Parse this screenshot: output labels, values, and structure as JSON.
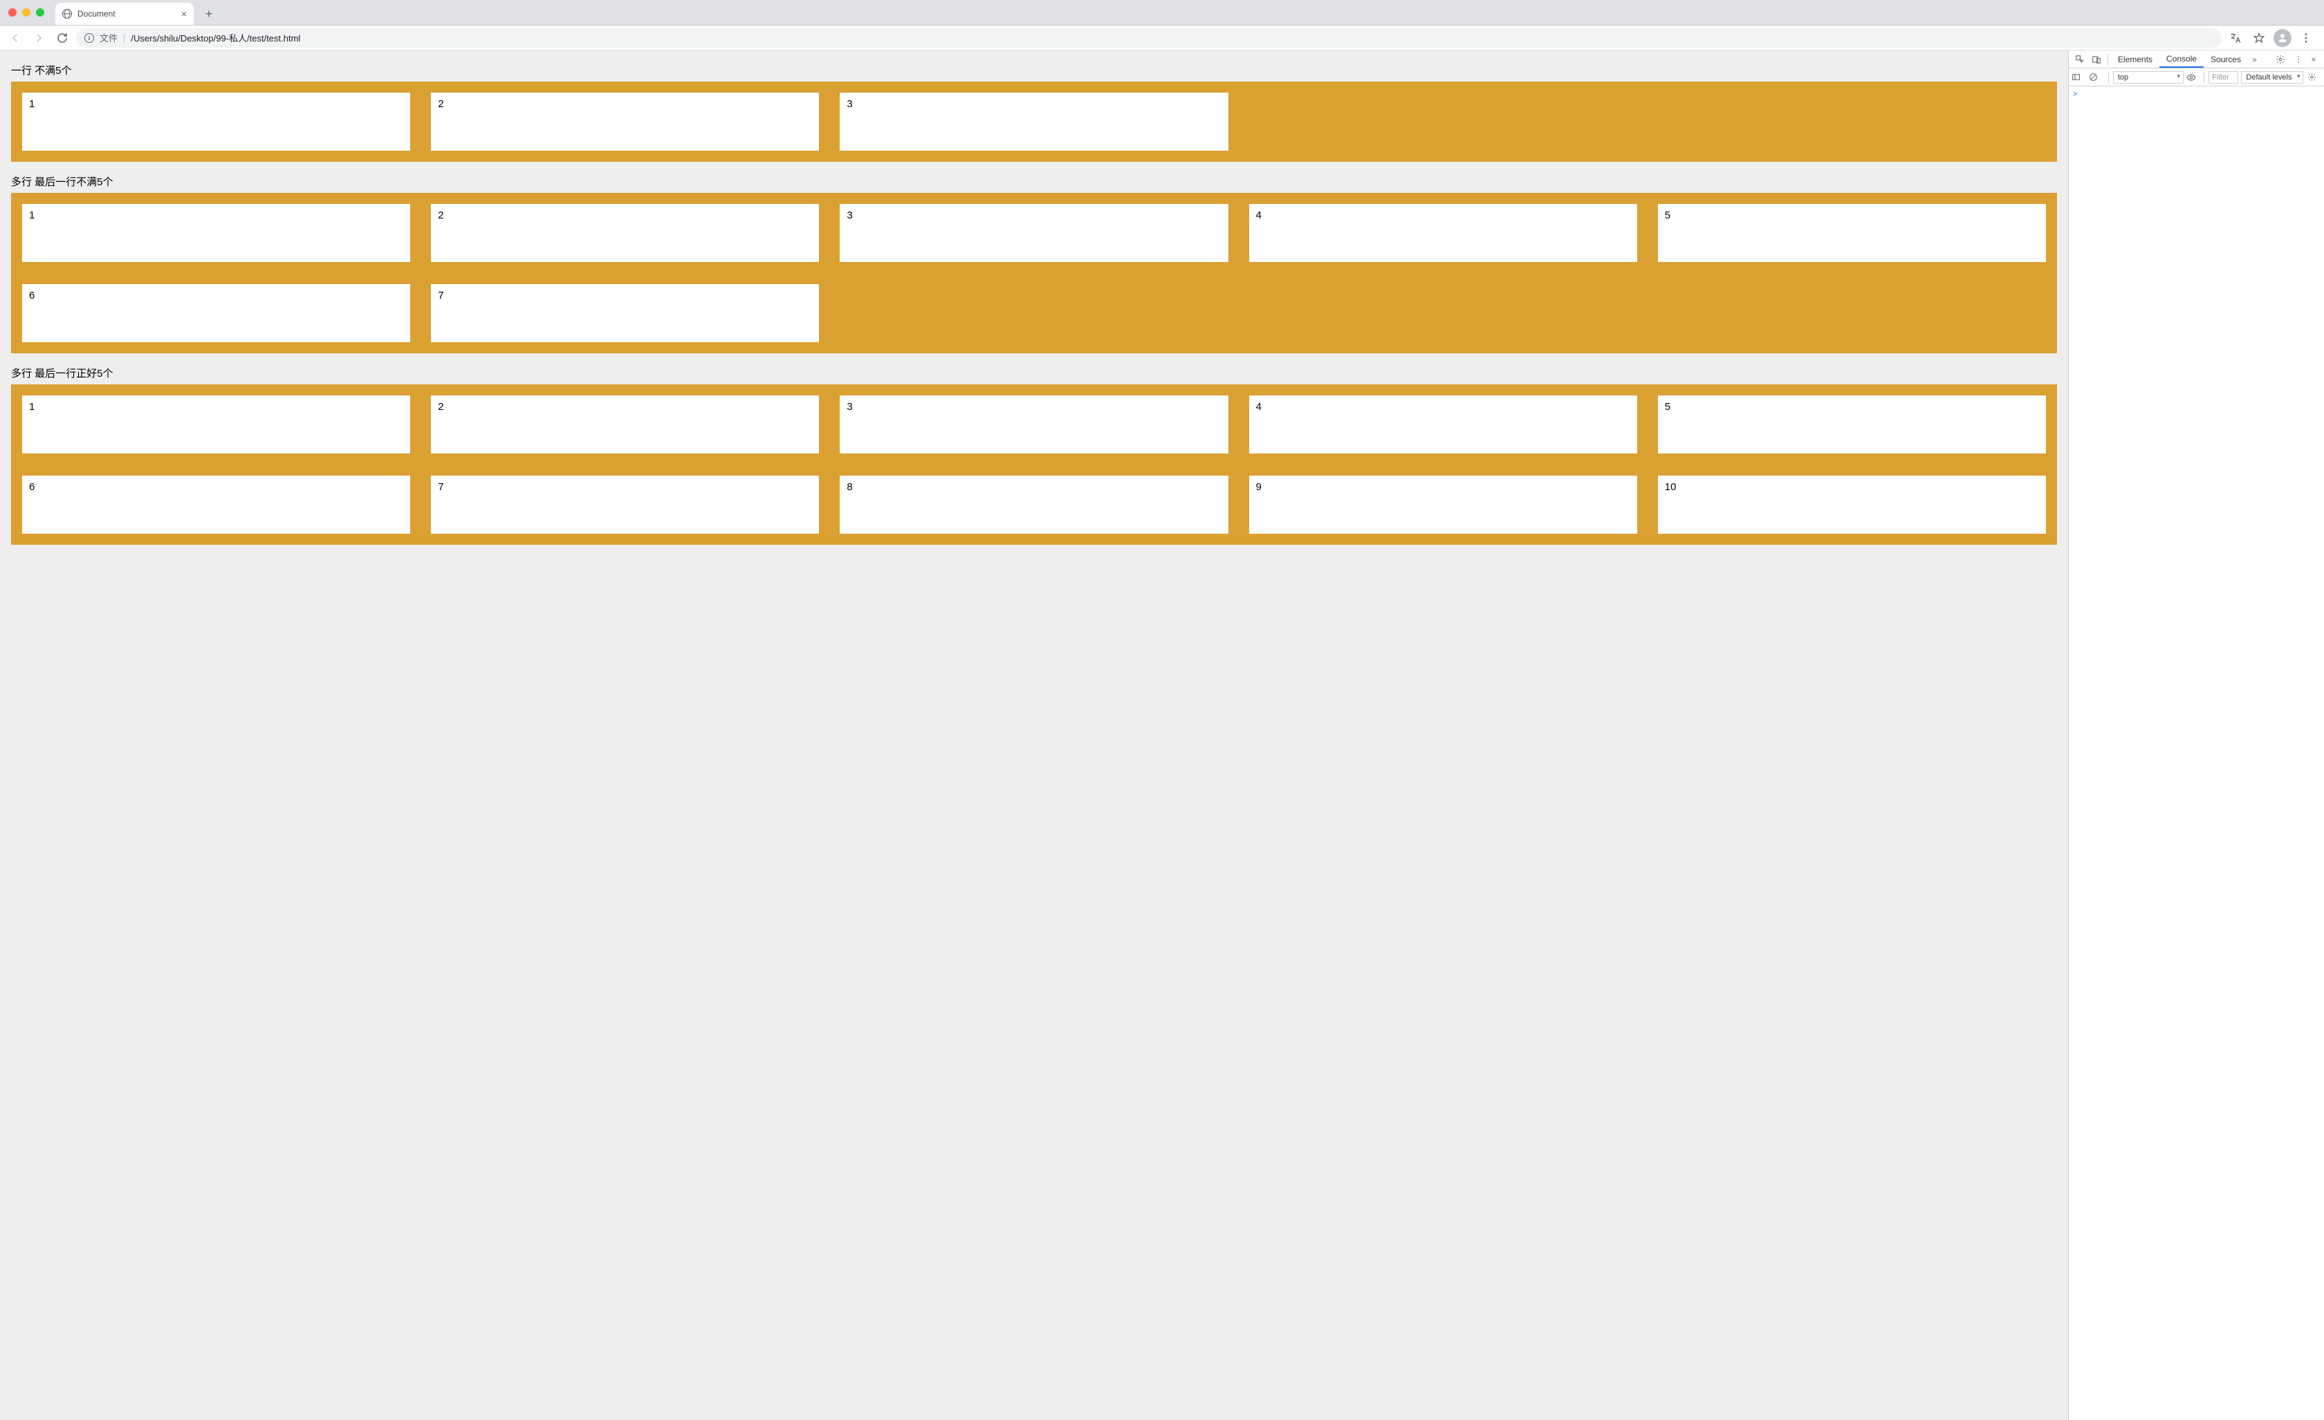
{
  "browser": {
    "tab_title": "Document",
    "url_info_label": "文件",
    "url_path": "/Users/shilu/Desktop/99-私人/test/test.html"
  },
  "sections": [
    {
      "title": "一行 不满5个",
      "cards": [
        "1",
        "2",
        "3"
      ]
    },
    {
      "title": "多行 最后一行不满5个",
      "cards": [
        "1",
        "2",
        "3",
        "4",
        "5",
        "6",
        "7"
      ]
    },
    {
      "title": "多行 最后一行正好5个",
      "cards": [
        "1",
        "2",
        "3",
        "4",
        "5",
        "6",
        "7",
        "8",
        "9",
        "10"
      ]
    }
  ],
  "devtools": {
    "tabs": {
      "elements": "Elements",
      "console": "Console",
      "sources": "Sources"
    },
    "context": "top",
    "filter_placeholder": "Filter",
    "levels": "Default levels",
    "prompt": ">"
  }
}
